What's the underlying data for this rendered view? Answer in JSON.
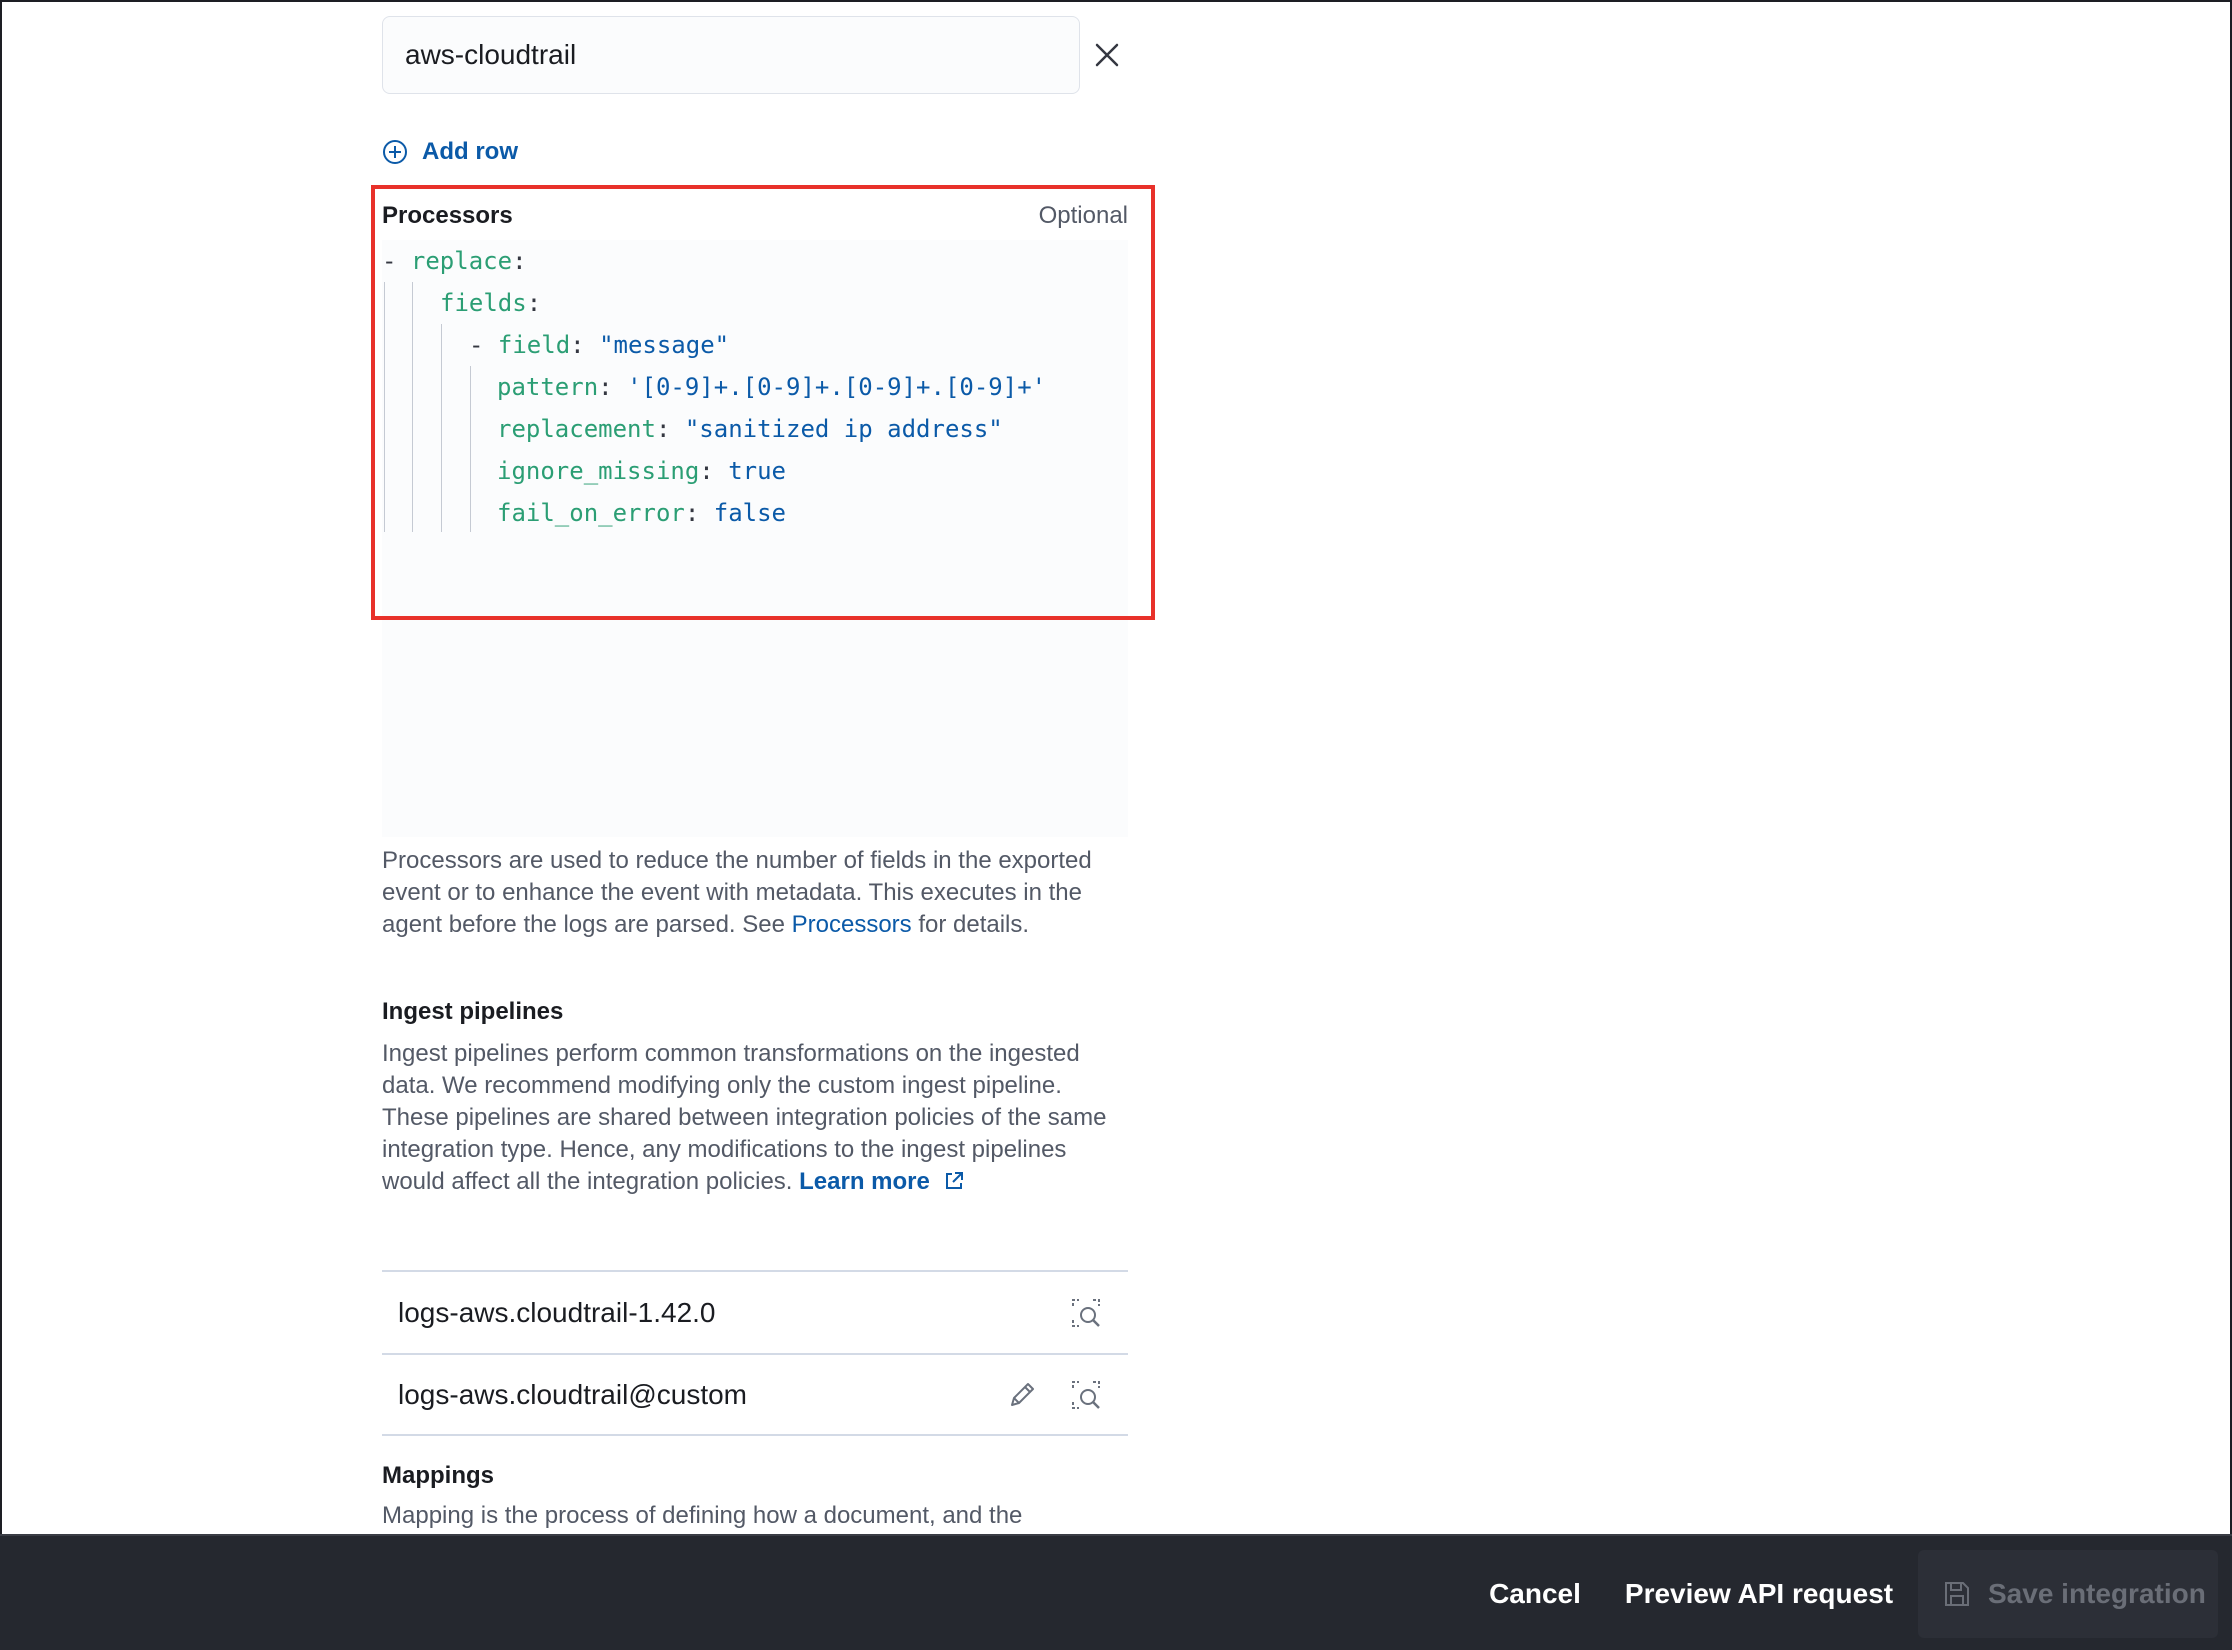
{
  "namespace_row": {
    "value": "aws-cloudtrail",
    "clear_icon": "close-icon"
  },
  "add_row": {
    "label": "Add row",
    "icon": "plus-circle-icon"
  },
  "processors": {
    "title": "Processors",
    "optional_label": "Optional",
    "code": {
      "l1_dash": "- ",
      "l1_key": "replace",
      "colon": ":",
      "l2_key": "fields",
      "l3_dash": "- ",
      "l3_key": "field",
      "l3_val": "\"message\"",
      "l4_key": "pattern",
      "l4_val": "'[0-9]+.[0-9]+.[0-9]+.[0-9]+'",
      "l5_key": "replacement",
      "l5_val": "\"sanitized ip address\"",
      "l6_key": "ignore_missing",
      "l6_val": "true",
      "l7_key": "fail_on_error",
      "l7_val": "false"
    },
    "help_before_link": "Processors are used to reduce the number of fields in the exported event or to enhance the event with metadata. This executes in the agent before the logs are parsed. See ",
    "help_link": "Processors",
    "help_after_link": " for details."
  },
  "ingest_pipelines": {
    "title": "Ingest pipelines",
    "description": "Ingest pipelines perform common transformations on the ingested data. We recommend modifying only the custom ingest pipeline. These pipelines are shared between integration policies of the same integration type. Hence, any modifications to the ingest pipelines would affect all the integration policies. ",
    "learn_more": "Learn more",
    "rows": [
      {
        "name": "logs-aws.cloudtrail-1.42.0"
      },
      {
        "name": "logs-aws.cloudtrail@custom"
      }
    ]
  },
  "mappings": {
    "title": "Mappings",
    "description": "Mapping is the process of defining how a document, and the"
  },
  "footer": {
    "cancel": "Cancel",
    "preview": "Preview API request",
    "save": "Save integration"
  }
}
